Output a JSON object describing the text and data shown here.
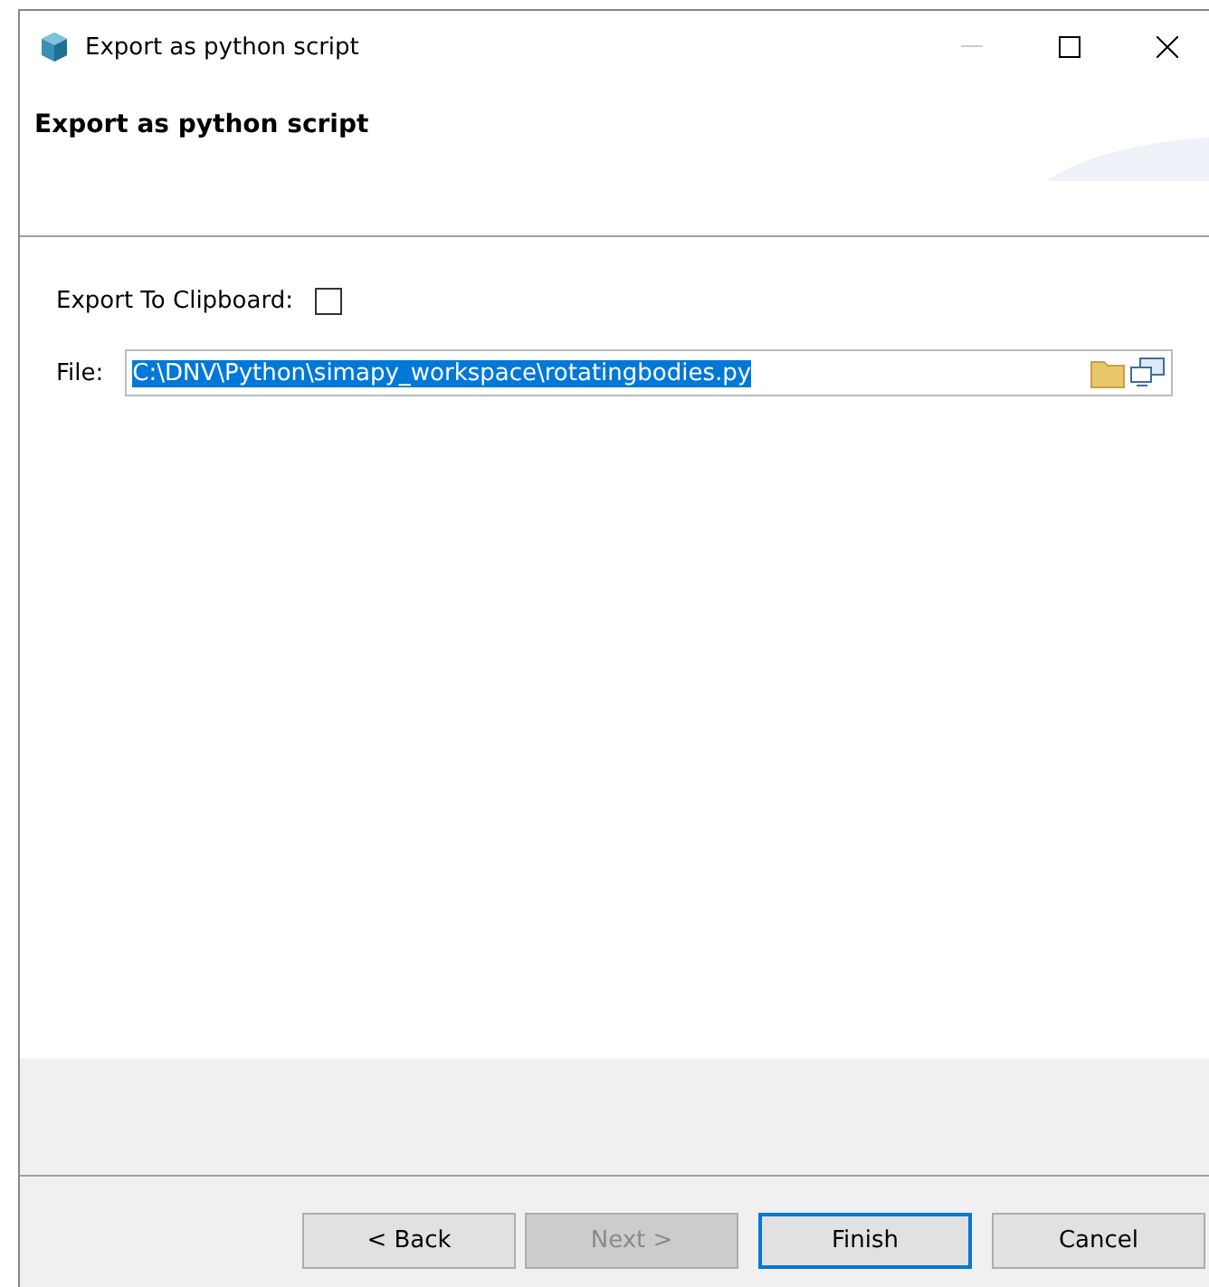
{
  "window": {
    "title": "Export as python script"
  },
  "header": {
    "title": "Export as python script"
  },
  "clipboard": {
    "label": "Export To Clipboard:",
    "checked": false
  },
  "file": {
    "label": "File:",
    "value": "C:\\DNV\\Python\\simapy_workspace\\rotatingbodies.py",
    "selected": true
  },
  "buttons": [
    {
      "label": "< Back",
      "disabled": false,
      "default": false
    },
    {
      "label": "Next >",
      "disabled": true,
      "default": false
    },
    {
      "label": "Finish",
      "disabled": false,
      "default": true
    },
    {
      "label": "Cancel",
      "disabled": false,
      "default": false
    }
  ]
}
